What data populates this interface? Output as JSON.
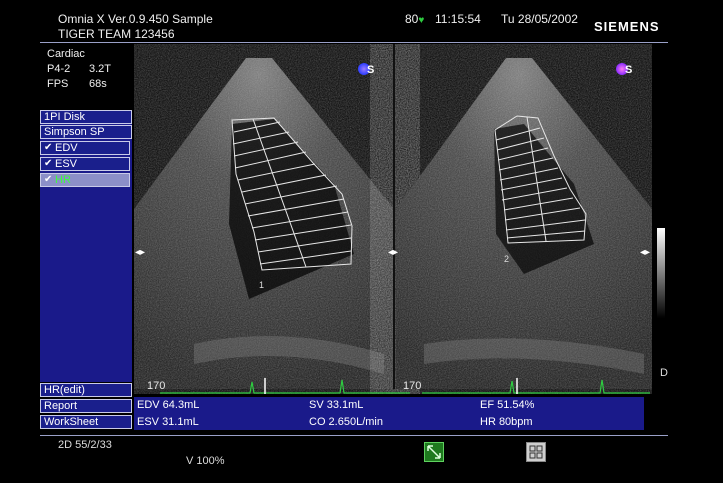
{
  "header": {
    "title": "Omnia X Ver.0.9.450 Sample",
    "patient": "TIGER TEAM 123456",
    "heart_rate_indicator": "80",
    "time": "11:15:54",
    "date": "Tu 28/05/2002",
    "brand": "SIEMENS"
  },
  "settings": {
    "exam": "Cardiac",
    "probe": "P4-2",
    "frequency": "3.2T",
    "fps_label": "FPS",
    "fps_value": "68s"
  },
  "menu": {
    "items": [
      {
        "label": "1PI Disk",
        "checked": false
      },
      {
        "label": "Simpson SP",
        "checked": false
      },
      {
        "label": "EDV",
        "checked": true
      },
      {
        "label": "ESV",
        "checked": true
      },
      {
        "label": "HR",
        "checked": true
      }
    ],
    "bottom": [
      "HR(edit)",
      "Report",
      "WorkSheet"
    ],
    "check_glyph": "✔"
  },
  "images": {
    "left_depth": "170",
    "right_depth": "170",
    "left_label": "1",
    "right_label": "2",
    "scale_label": "D",
    "orientation_marker": "S"
  },
  "measurements": {
    "edv": "EDV  64.3mL",
    "esv": "ESV  31.1mL",
    "sv": "SV  33.1mL",
    "co": "CO  2.650L/min",
    "ef": "EF  51.54%",
    "hr": "HR  80bpm"
  },
  "footer": {
    "mode": "2D 55/2/33",
    "volume": "V 100%"
  },
  "colors": {
    "menu_bg": "#1a1f8c",
    "measure_bg": "#1a1a8a",
    "ecg": "#2ecc40",
    "heart": "#2ecc40"
  }
}
